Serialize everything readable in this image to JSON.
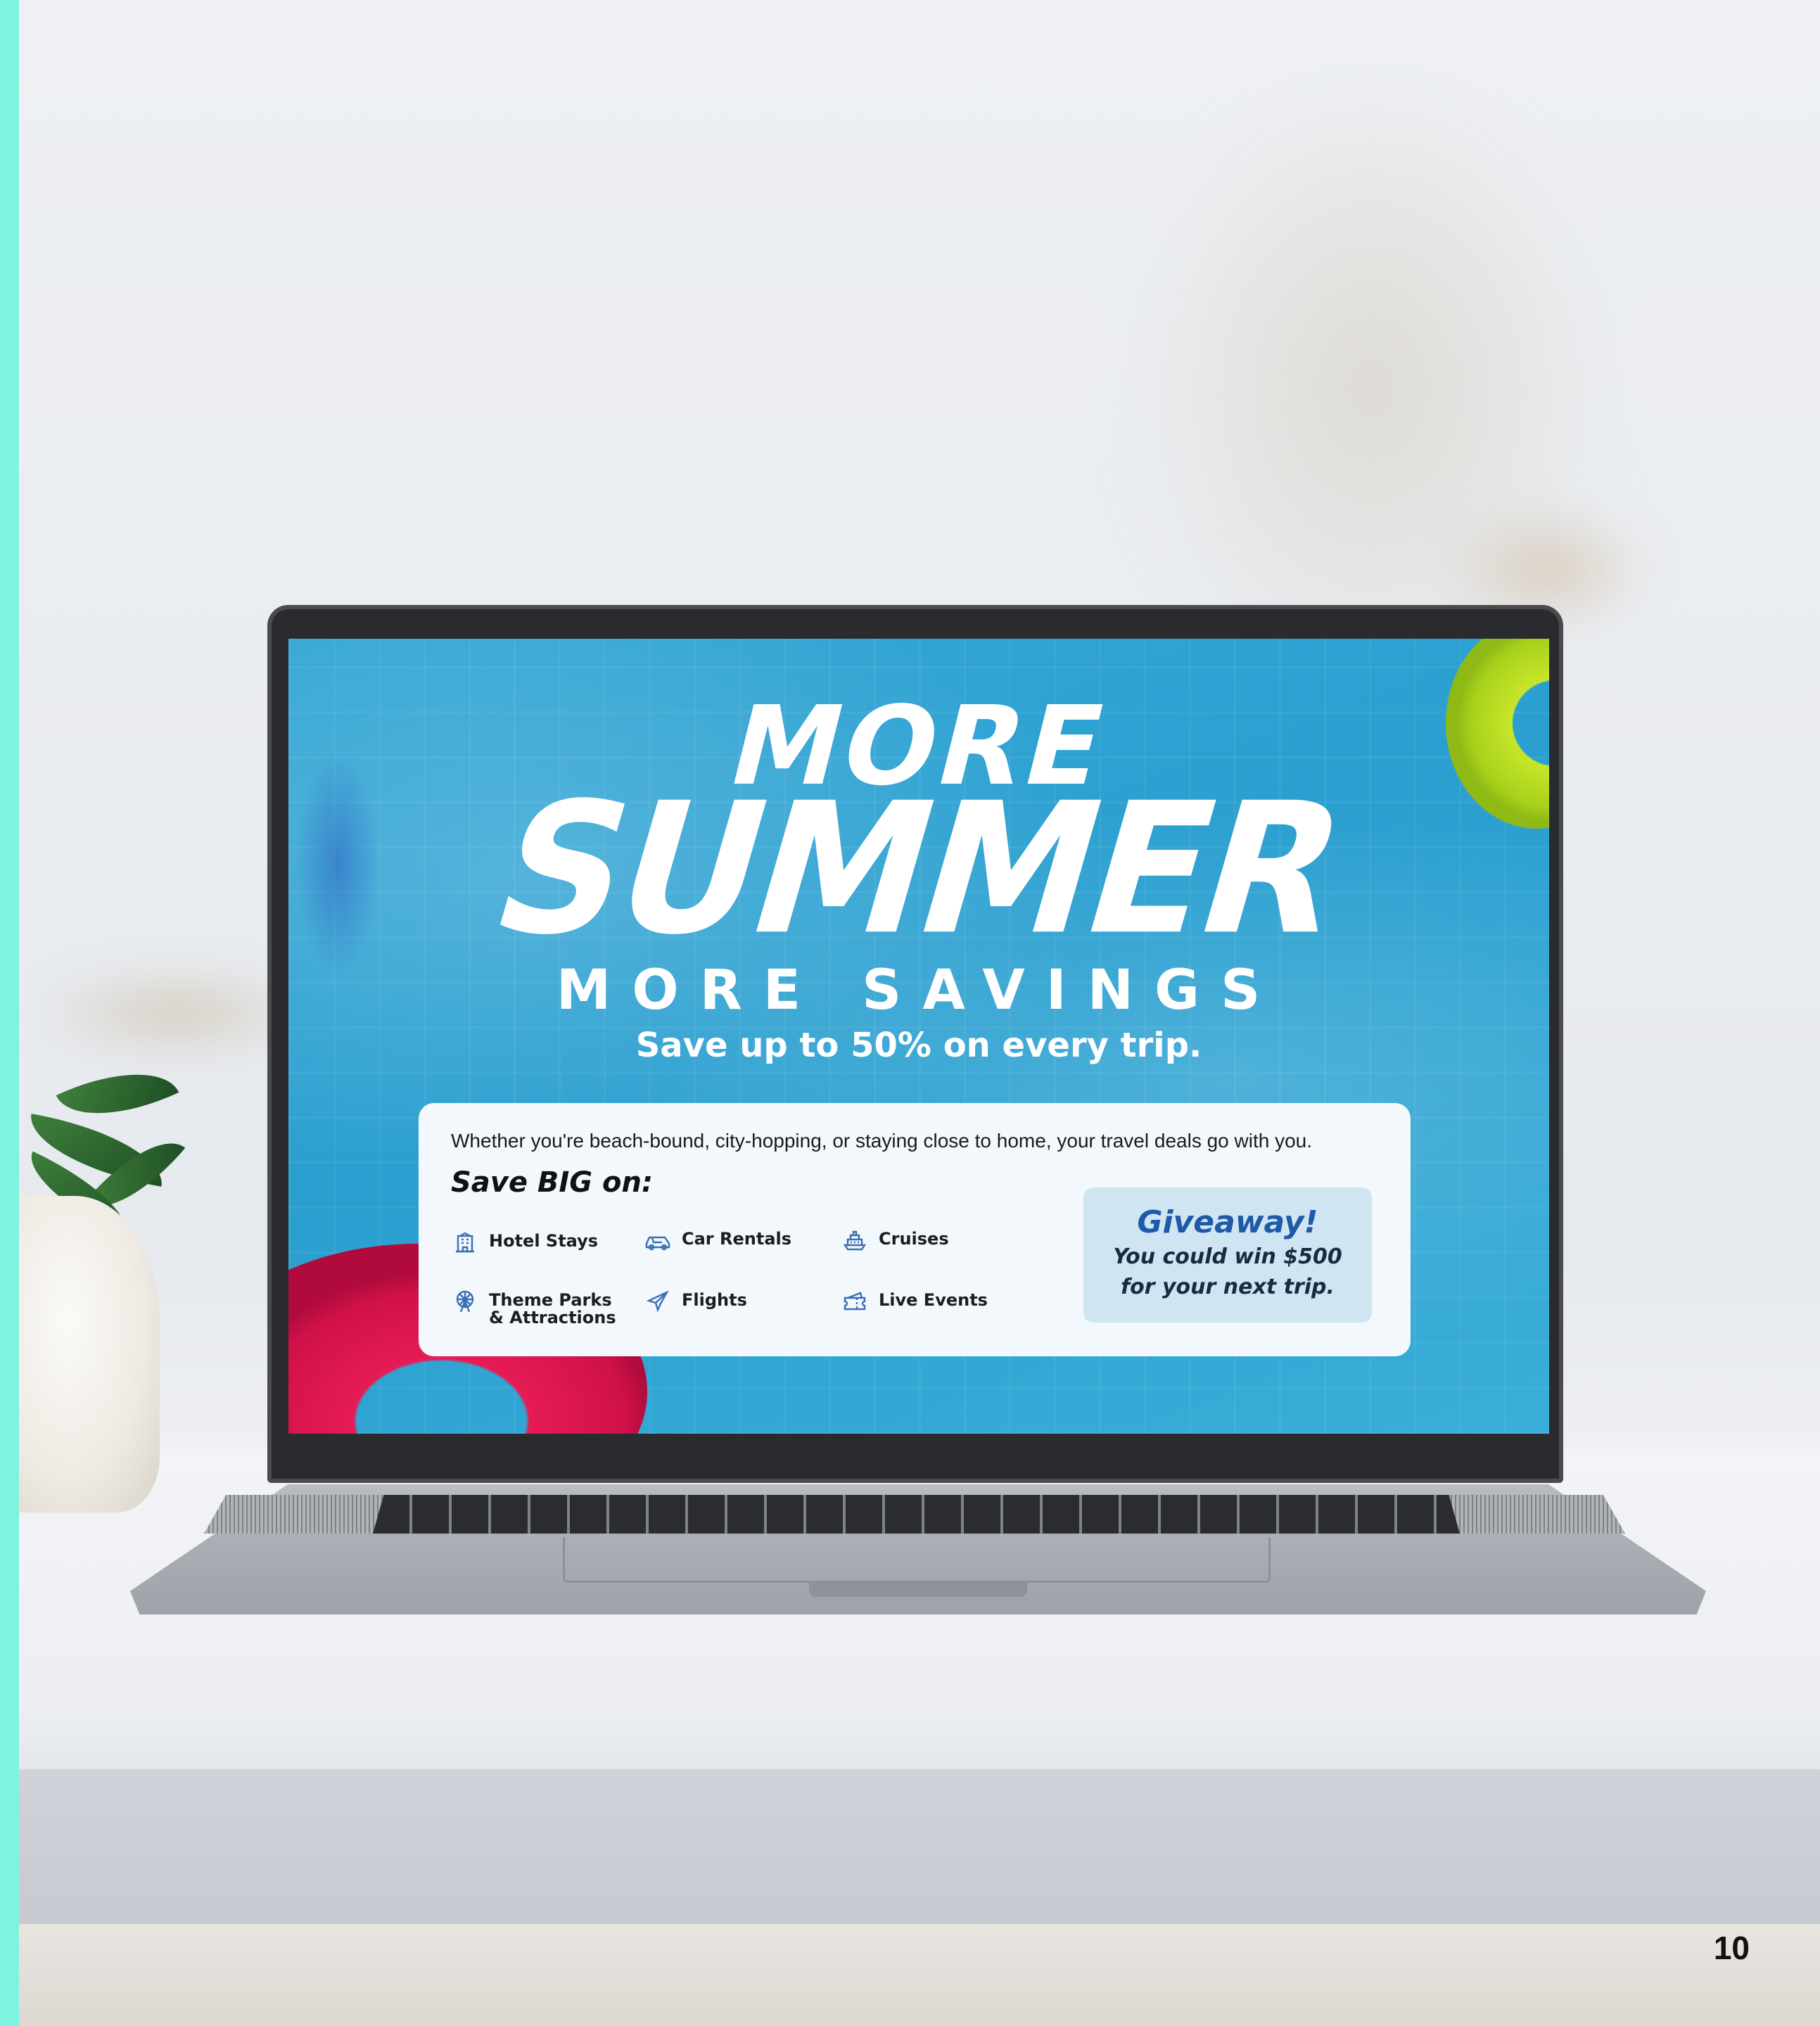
{
  "colors": {
    "accent_strip": "#7df5de",
    "pool_blue": "#2ea2d3",
    "headline": "#ffffff",
    "card_background": "#f2f8fc",
    "giveaway_background": "#cfe6f2",
    "giveaway_title": "#1f5aa8",
    "icon_blue": "#3a6fb3"
  },
  "screen": {
    "headline_more": "MORE",
    "headline_summer": "SUMMER",
    "headline_savings": "MORE SAVINGS",
    "tagline": "Save up to 50% on every trip."
  },
  "deal_card": {
    "intro": "Whether you're beach-bound, city-hopping, or staying close to home, your travel deals go with you.",
    "save_big": "Save BIG on:",
    "categories": [
      {
        "label": "Hotel Stays",
        "icon": "hotel-icon"
      },
      {
        "label": "Car Rentals",
        "icon": "car-icon"
      },
      {
        "label": "Cruises",
        "icon": "ship-icon"
      },
      {
        "label": "Theme Parks & Attractions",
        "icon": "ferris-wheel-icon"
      },
      {
        "label": "Flights",
        "icon": "airplane-icon"
      },
      {
        "label": "Live Events",
        "icon": "ticket-icon"
      }
    ],
    "giveaway": {
      "title": "Giveaway!",
      "line1": "You could win $500",
      "line2": "for your next trip."
    }
  },
  "page": {
    "number": "10"
  }
}
